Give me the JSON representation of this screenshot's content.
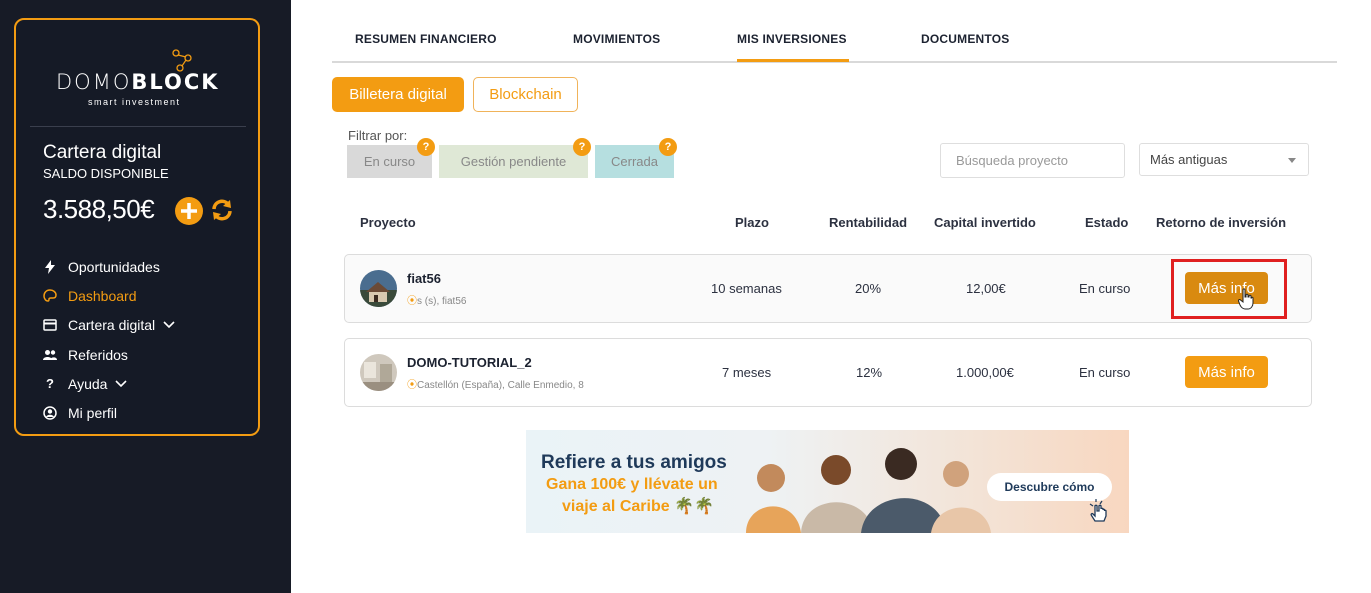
{
  "brand": {
    "name_light": "DOMO",
    "name_bold": "BLOCK",
    "tagline": "smart investment"
  },
  "wallet": {
    "title": "Cartera digital",
    "subtitle": "SALDO DISPONIBLE",
    "balance": "3.588,50€"
  },
  "sidebar": {
    "items": [
      {
        "label": "Oportunidades",
        "icon": "bolt-icon",
        "active": false
      },
      {
        "label": "Dashboard",
        "icon": "palette-icon",
        "active": true
      },
      {
        "label": "Cartera digital",
        "icon": "card-icon",
        "active": false,
        "has_chevron": true
      },
      {
        "label": "Referidos",
        "icon": "users-icon",
        "active": false
      },
      {
        "label": "Ayuda",
        "icon": "question-icon",
        "active": false,
        "has_chevron": true
      },
      {
        "label": "Mi perfil",
        "icon": "user-circle-icon",
        "active": false
      }
    ]
  },
  "tabs": [
    {
      "label": "RESUMEN FINANCIERO"
    },
    {
      "label": "MOVIMIENTOS"
    },
    {
      "label": "MIS INVERSIONES",
      "active": true
    },
    {
      "label": "DOCUMENTOS"
    }
  ],
  "subtabs": {
    "primary": "Billetera digital",
    "secondary": "Blockchain"
  },
  "filters": {
    "label": "Filtrar por:",
    "chips": [
      "En curso",
      "Gestión pendiente",
      "Cerrada"
    ],
    "help": "?"
  },
  "search": {
    "placeholder": "Búsqueda proyecto"
  },
  "sort": {
    "selected": "Más antiguas"
  },
  "table": {
    "headers": [
      "Proyecto",
      "Plazo",
      "Rentabilidad",
      "Capital invertido",
      "Estado",
      "Retorno de inversión"
    ],
    "rows": [
      {
        "name": "fiat56",
        "location": "s (s), fiat56",
        "plazo": "10 semanas",
        "rentabilidad": "20%",
        "capital": "12,00€",
        "estado": "En curso",
        "action": "Más info"
      },
      {
        "name": "DOMO-TUTORIAL_2",
        "location": "Castellón (España), Calle Enmedio, 8",
        "plazo": "7 meses",
        "rentabilidad": "12%",
        "capital": "1.000,00€",
        "estado": "En curso",
        "action": "Más info"
      }
    ]
  },
  "banner": {
    "title": "Refiere a tus amigos",
    "line2": "Gana 100€ y llévate un",
    "line3": "viaje al Caribe 🌴🌴",
    "cta": "Descubre cómo"
  },
  "colors": {
    "accent": "#f39c12",
    "sidebar_bg": "#171b26",
    "highlight": "#e02020"
  }
}
